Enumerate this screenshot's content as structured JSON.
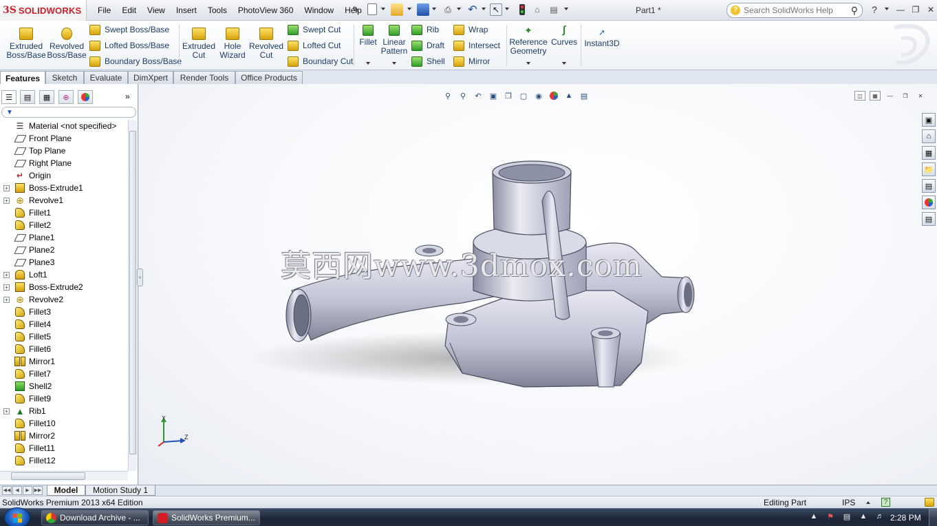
{
  "app": {
    "logo_mark": "3S",
    "logo_text": "SOLIDWORKS",
    "document_title": "Part1 *"
  },
  "menu": [
    "File",
    "Edit",
    "View",
    "Insert",
    "Tools",
    "PhotoView 360",
    "Window",
    "Help"
  ],
  "search": {
    "placeholder": "Search SolidWorks Help"
  },
  "ribbon": {
    "extruded_boss": "Extruded Boss/Base",
    "revolved_boss": "Revolved Boss/Base",
    "swept_boss": "Swept Boss/Base",
    "lofted_boss": "Lofted Boss/Base",
    "boundary_boss": "Boundary Boss/Base",
    "extruded_cut": "Extruded Cut",
    "hole_wizard": "Hole Wizard",
    "revolved_cut": "Revolved Cut",
    "swept_cut": "Swept Cut",
    "lofted_cut": "Lofted Cut",
    "boundary_cut": "Boundary Cut",
    "fillet": "Fillet",
    "linear_pattern": "Linear Pattern",
    "rib": "Rib",
    "draft": "Draft",
    "shell": "Shell",
    "wrap": "Wrap",
    "intersect": "Intersect",
    "mirror": "Mirror",
    "reference_geometry": "Reference Geometry",
    "curves": "Curves",
    "instant3d": "Instant3D"
  },
  "tabs": [
    "Features",
    "Sketch",
    "Evaluate",
    "DimXpert",
    "Render Tools",
    "Office Products"
  ],
  "feature_tree": [
    {
      "label": "Material <not specified>",
      "icon": "material-icon",
      "expandable": false
    },
    {
      "label": "Front Plane",
      "icon": "plane-icon",
      "expandable": false
    },
    {
      "label": "Top Plane",
      "icon": "plane-icon",
      "expandable": false
    },
    {
      "label": "Right Plane",
      "icon": "plane-icon",
      "expandable": false
    },
    {
      "label": "Origin",
      "icon": "origin-icon",
      "expandable": false
    },
    {
      "label": "Boss-Extrude1",
      "icon": "boss-extrude-icon",
      "expandable": true
    },
    {
      "label": "Revolve1",
      "icon": "revolve-icon",
      "expandable": true
    },
    {
      "label": "Fillet1",
      "icon": "fillet-icon",
      "expandable": false
    },
    {
      "label": "Fillet2",
      "icon": "fillet-icon",
      "expandable": false
    },
    {
      "label": "Plane1",
      "icon": "plane-icon",
      "expandable": false
    },
    {
      "label": "Plane2",
      "icon": "plane-icon",
      "expandable": false
    },
    {
      "label": "Plane3",
      "icon": "plane-icon",
      "expandable": false
    },
    {
      "label": "Loft1",
      "icon": "loft-icon",
      "expandable": true
    },
    {
      "label": "Boss-Extrude2",
      "icon": "boss-extrude-icon",
      "expandable": true
    },
    {
      "label": "Revolve2",
      "icon": "revolve-icon",
      "expandable": true
    },
    {
      "label": "Fillet3",
      "icon": "fillet-icon",
      "expandable": false
    },
    {
      "label": "Fillet4",
      "icon": "fillet-icon",
      "expandable": false
    },
    {
      "label": "Fillet5",
      "icon": "fillet-icon",
      "expandable": false
    },
    {
      "label": "Fillet6",
      "icon": "fillet-icon",
      "expandable": false
    },
    {
      "label": "Mirror1",
      "icon": "mirror-icon",
      "expandable": false
    },
    {
      "label": "Fillet7",
      "icon": "fillet-icon",
      "expandable": false
    },
    {
      "label": "Shell2",
      "icon": "shell-icon",
      "expandable": false
    },
    {
      "label": "Fillet9",
      "icon": "fillet-icon",
      "expandable": false
    },
    {
      "label": "Rib1",
      "icon": "rib-icon",
      "expandable": true
    },
    {
      "label": "Fillet10",
      "icon": "fillet-icon",
      "expandable": false
    },
    {
      "label": "Mirror2",
      "icon": "mirror-icon",
      "expandable": false
    },
    {
      "label": "Fillet11",
      "icon": "fillet-icon",
      "expandable": false
    },
    {
      "label": "Fillet12",
      "icon": "fillet-icon",
      "expandable": false
    }
  ],
  "viewport": {
    "watermark": "莫西网www.3dmox.com",
    "triad_y": "Y",
    "triad_z": "Z"
  },
  "model_tabs": [
    "Model",
    "Motion Study 1"
  ],
  "status": {
    "edition": "SolidWorks Premium 2013 x64 Edition",
    "mode": "Editing Part",
    "units": "IPS",
    "help": "?"
  },
  "taskbar": {
    "tasks": [
      "Download Archive - ...",
      "SolidWorks Premium..."
    ],
    "clock": "2:28 PM"
  },
  "colors": {
    "brand_red": "#d21f26",
    "part_body": "#c9cbd8",
    "ribbon_text": "#1b3b6b"
  }
}
